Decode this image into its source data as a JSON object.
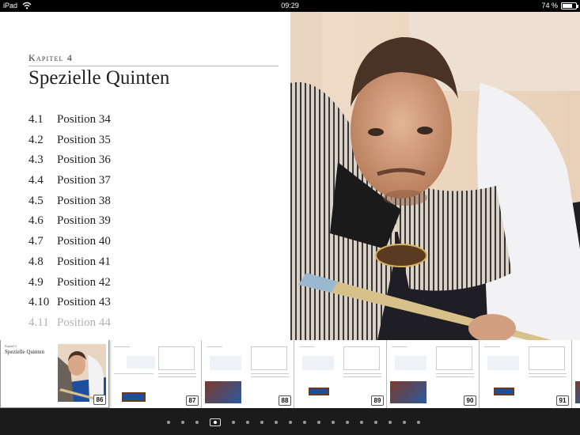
{
  "statusbar": {
    "device": "iPad",
    "time": "09:29",
    "battery": "74 %",
    "battery_level": 0.74
  },
  "chapter": {
    "kicker": "Kapitel 4",
    "title": "Spezielle Quinten",
    "toc": [
      {
        "num": "4.1",
        "label": "Position 34"
      },
      {
        "num": "4.2",
        "label": "Position 35"
      },
      {
        "num": "4.3",
        "label": "Position 36"
      },
      {
        "num": "4.4",
        "label": "Position 37"
      },
      {
        "num": "4.5",
        "label": "Position 38"
      },
      {
        "num": "4.6",
        "label": "Position 39"
      },
      {
        "num": "4.7",
        "label": "Position 40"
      },
      {
        "num": "4.8",
        "label": "Position 41"
      },
      {
        "num": "4.9",
        "label": "Position 42"
      },
      {
        "num": "4.10",
        "label": "Position 43"
      },
      {
        "num": "4.11",
        "label": "Position 44"
      }
    ]
  },
  "thumbnails": {
    "current": {
      "kicker": "Kapitel 4",
      "title": "Spezielle Quinten",
      "page": "86"
    },
    "pages": [
      "87",
      "88",
      "89",
      "90",
      "91"
    ]
  },
  "pager": {
    "dot_count": 18,
    "current_index": 3
  },
  "colors": {
    "accent": "#1c4fa0",
    "strip_bg": "#d8d8d8",
    "dock_bg": "#1b1b1b"
  }
}
